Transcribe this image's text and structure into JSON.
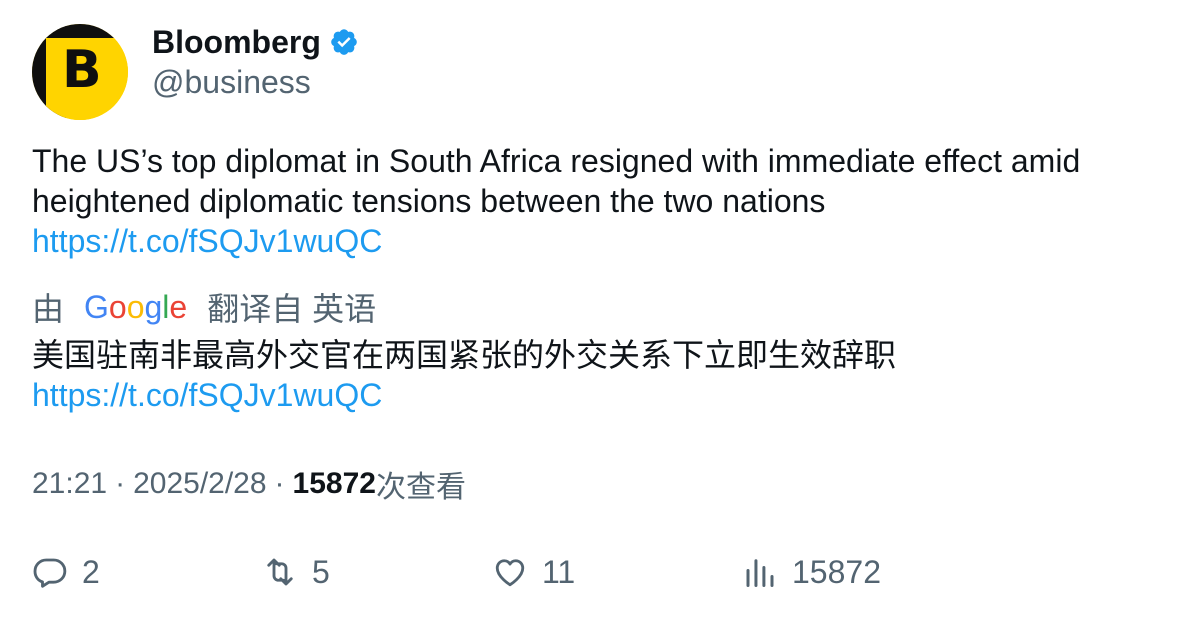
{
  "author": {
    "name": "Bloomberg",
    "handle": "@business",
    "avatar_letter": "B",
    "verified": true,
    "brand_color": "#ffd400"
  },
  "tweet": {
    "text": "The US’s top diplomat in South Africa resigned with immediate effect amid heightened diplomatic tensions between the two nations",
    "link": "https://t.co/fSQJv1wuQC"
  },
  "translation": {
    "prefix": "由",
    "provider": "Google",
    "suffix": "翻译自 英语",
    "text": "美国驻南非最高外交官在两国紧张的外交关系下立即生效辞职",
    "link": "https://t.co/fSQJv1wuQC"
  },
  "meta": {
    "time": "21:21",
    "separator": "·",
    "date": "2025/2/28",
    "views_count": "15872",
    "views_label": "次查看"
  },
  "actions": {
    "replies": "2",
    "reposts": "5",
    "likes": "11",
    "views": "15872"
  },
  "colors": {
    "link": "#1d9bf0",
    "secondary_text": "#536471",
    "primary_text": "#0f1419",
    "verified": "#1d9bf0"
  }
}
